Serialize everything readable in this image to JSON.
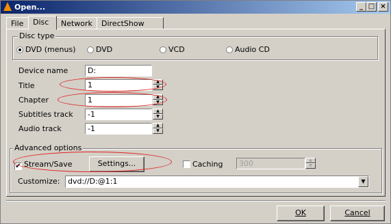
{
  "window": {
    "title": "Open...",
    "minimize": "_",
    "maximize": "□",
    "close": "×"
  },
  "tabs": [
    "File",
    "Disc",
    "Network",
    "DirectShow"
  ],
  "disc_type": {
    "legend": "Disc type",
    "options": [
      "DVD (menus)",
      "DVD",
      "VCD",
      "Audio CD"
    ],
    "selected": "DVD (menus)"
  },
  "fields": {
    "device_name": {
      "label": "Device name",
      "value": "D:"
    },
    "title": {
      "label": "Title",
      "value": "1"
    },
    "chapter": {
      "label": "Chapter",
      "value": "1"
    },
    "subtitles": {
      "label": "Subtitles track",
      "value": "-1"
    },
    "audio": {
      "label": "Audio track",
      "value": "-1"
    }
  },
  "advanced": {
    "legend": "Advanced options",
    "stream_save": {
      "label": "Stream/Save",
      "checked": true
    },
    "settings_button": "Settings...",
    "caching": {
      "label": "Caching",
      "checked": false,
      "value": "300"
    },
    "customize": {
      "label": "Customize:",
      "value": "dvd://D:@1:1"
    }
  },
  "buttons": {
    "ok": "OK",
    "cancel": "Cancel"
  },
  "annotation_color": "#e02020"
}
